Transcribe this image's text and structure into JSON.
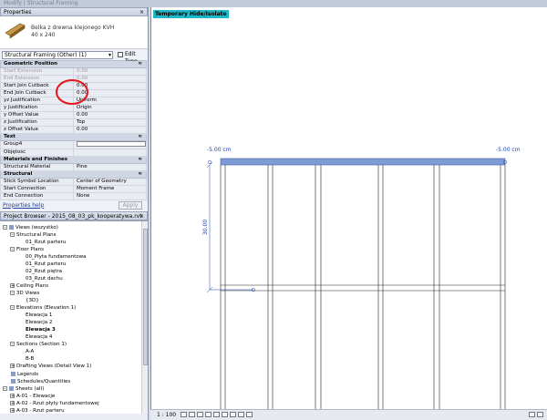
{
  "window_title": "Modify | Structural Framing",
  "properties": {
    "header": "Properties",
    "close": "×",
    "type_name_line1": "Belka z drewna klejonego KVH",
    "type_name_line2": "40 x 240",
    "selector": "Structural Framing (Other) (1)",
    "edit_type": "Edit Type",
    "groups": [
      {
        "name": "Geometric Position",
        "rows": [
          {
            "k": "Start Extension",
            "v": "0.00",
            "dis": true
          },
          {
            "k": "End Extension",
            "v": "0.00",
            "dis": true
          },
          {
            "k": "Start Join Cutback",
            "v": "0.00"
          },
          {
            "k": "End Join Cutback",
            "v": "0.00"
          },
          {
            "k": "yz Justification",
            "v": "Uniform"
          },
          {
            "k": "y Justification",
            "v": "Origin"
          },
          {
            "k": "y Offset Value",
            "v": "0.00"
          },
          {
            "k": "z Justification",
            "v": "Top"
          },
          {
            "k": "z Offset Value",
            "v": "0.00"
          }
        ]
      },
      {
        "name": "Text",
        "rows": [
          {
            "k": "Group4",
            "v": "",
            "box": true
          },
          {
            "k": "Objętość",
            "v": ""
          }
        ]
      },
      {
        "name": "Materials and Finishes",
        "rows": [
          {
            "k": "Structural Material",
            "v": "Pine"
          }
        ]
      },
      {
        "name": "Structural",
        "rows": [
          {
            "k": "Stick Symbol Location",
            "v": "Center of Geometry"
          },
          {
            "k": "Start Connection",
            "v": "Moment Frame"
          },
          {
            "k": "End Connection",
            "v": "None"
          }
        ]
      }
    ],
    "help_link": "Properties help",
    "apply": "Apply"
  },
  "browser": {
    "header": "Project Browser - 2015_08_03_pk_kooperatywa.rvt",
    "items": [
      {
        "t": "Views (wszystko)",
        "lvl": 0,
        "exp": "-",
        "icon": true
      },
      {
        "t": "Structural Plans",
        "lvl": 1,
        "exp": "-"
      },
      {
        "t": "01_Rzut parteru",
        "lvl": 2
      },
      {
        "t": "Floor Plans",
        "lvl": 1,
        "exp": "-"
      },
      {
        "t": "00_Płyta fundamentowa",
        "lvl": 2
      },
      {
        "t": "01_Rzut parteru",
        "lvl": 2
      },
      {
        "t": "02_Rzut piętra",
        "lvl": 2
      },
      {
        "t": "03_Rzut dachu",
        "lvl": 2
      },
      {
        "t": "Ceiling Plans",
        "lvl": 1,
        "exp": "+"
      },
      {
        "t": "3D Views",
        "lvl": 1,
        "exp": "-"
      },
      {
        "t": "{3D}",
        "lvl": 2
      },
      {
        "t": "Elevations (Elevation 1)",
        "lvl": 1,
        "exp": "-"
      },
      {
        "t": "Elewacja 1",
        "lvl": 2
      },
      {
        "t": "Elewacja 2",
        "lvl": 2
      },
      {
        "t": "Elewacja 3",
        "lvl": 2,
        "bold": true
      },
      {
        "t": "Elewacja 4",
        "lvl": 2
      },
      {
        "t": "Sections (Section 1)",
        "lvl": 1,
        "exp": "-"
      },
      {
        "t": "A-A",
        "lvl": 2
      },
      {
        "t": "B-B",
        "lvl": 2
      },
      {
        "t": "Drafting Views (Detail View 1)",
        "lvl": 1,
        "exp": "+"
      },
      {
        "t": "Legends",
        "lvl": 0,
        "icon": true
      },
      {
        "t": "Schedules/Quantities",
        "lvl": 0,
        "icon": true
      },
      {
        "t": "Sheets (all)",
        "lvl": 0,
        "exp": "-",
        "icon": true
      },
      {
        "t": "A-01 - Elewacje",
        "lvl": 1,
        "exp": "+"
      },
      {
        "t": "A-02 - Rzut płyty fundamentowej",
        "lvl": 1,
        "exp": "+"
      },
      {
        "t": "A-03 - Rzut parteru",
        "lvl": 1,
        "exp": "+"
      }
    ]
  },
  "view": {
    "title": "Temporary Hide/Isolate",
    "left_offset": "-5.00 cm",
    "right_offset": "-5.00 cm",
    "dim_label": "30.00",
    "scale": "1 : 100"
  },
  "colors": {
    "beam": "#7f9bd6",
    "annotation_circle": "#e3141b",
    "title_bg": "#1cb8c9"
  }
}
